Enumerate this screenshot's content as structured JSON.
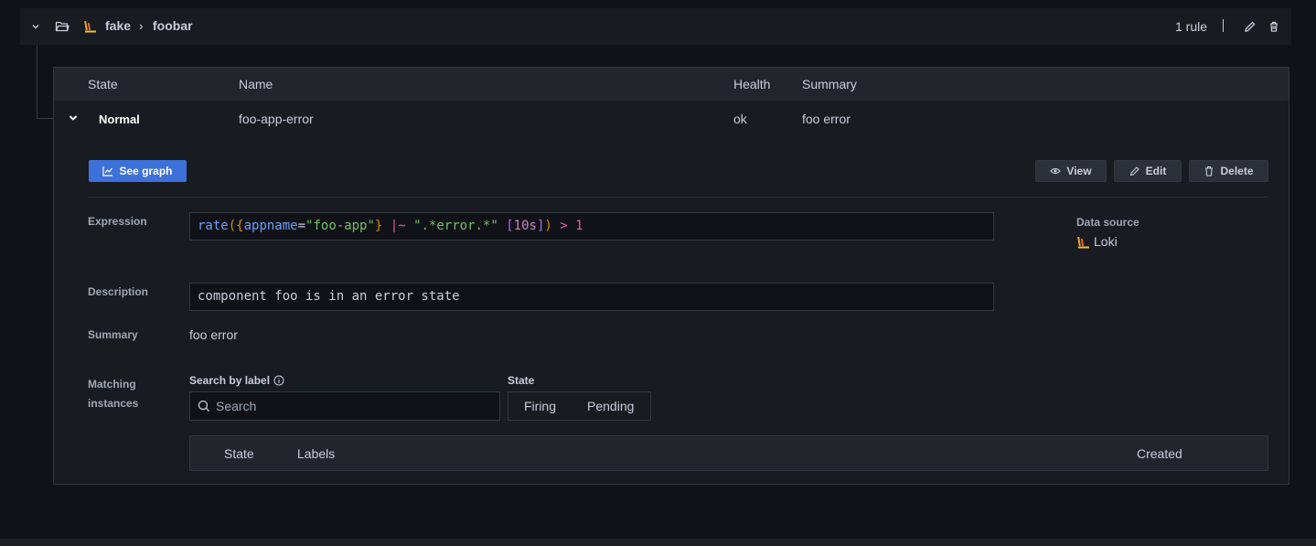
{
  "group": {
    "namespace": "fake",
    "separator": "›",
    "name": "foobar",
    "rule_count": "1 rule"
  },
  "table": {
    "headers": {
      "state": "State",
      "name": "Name",
      "health": "Health",
      "summary": "Summary"
    },
    "row": {
      "state": "Normal",
      "name": "foo-app-error",
      "health": "ok",
      "summary": "foo error"
    }
  },
  "actions": {
    "see_graph": "See graph",
    "view": "View",
    "edit": "Edit",
    "delete": "Delete"
  },
  "details": {
    "expression_label": "Expression",
    "expression_tokens": {
      "fn": "rate",
      "open_paren": "(",
      "open_brace": "{",
      "label": "appname",
      "eq": "=",
      "value": "\"foo-app\"",
      "close_brace": "}",
      "op": " |~ ",
      "regex": "\".*error.*\"",
      "space": " ",
      "range_open": "[",
      "range": "10s",
      "range_close": "]",
      "close_paren": ")",
      "cmp": " > ",
      "threshold": "1"
    },
    "datasource_label": "Data source",
    "datasource_name": "Loki",
    "description_label": "Description",
    "description_value": "component foo is in an error state",
    "summary_label": "Summary",
    "summary_value": "foo error",
    "matching_label_line1": "Matching",
    "matching_label_line2": "instances"
  },
  "instances": {
    "search_label": "Search by label",
    "search_placeholder": "Search",
    "state_label": "State",
    "state_options": [
      "Firing",
      "Pending"
    ],
    "headers": {
      "state": "State",
      "labels": "Labels",
      "created": "Created"
    }
  },
  "icons": {
    "collapse": "chevron-down-icon",
    "folder": "folder-open-icon",
    "datasource": "loki-logo",
    "edit": "pen-icon",
    "delete": "trash-icon",
    "graph": "graph-icon",
    "view": "eye-icon",
    "info": "info-circle-icon",
    "search": "search-icon"
  },
  "colors": {
    "background": "#111217",
    "panel": "#181b1f",
    "primary": "#3d71d9"
  }
}
